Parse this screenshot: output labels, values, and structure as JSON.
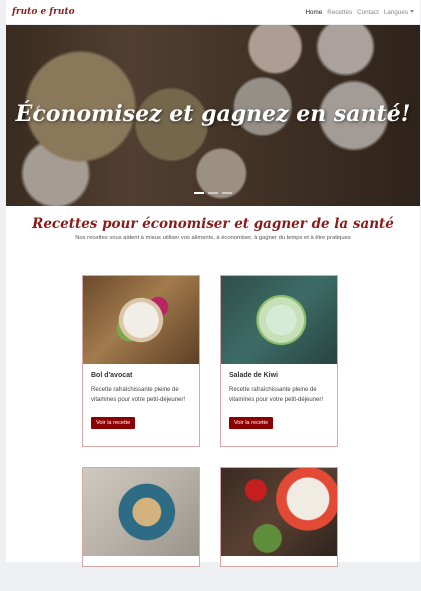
{
  "navbar": {
    "brand": "fruto e fruto",
    "links": [
      "Home",
      "Recettes",
      "Contact",
      "Langues"
    ]
  },
  "hero": {
    "title": "Économisez et gagnez en santé!"
  },
  "section": {
    "title": "Recettes pour économiser et gagner de la santé",
    "subtitle": "Nos recettes vous aident à mieux utiliser vos aliments, à économiser, à gagner du temps et à être pratiques"
  },
  "cards": [
    {
      "title": "Bol d'avocat",
      "text": "Recette rafraîchissante pleine de vitamines pour votre petit-déjeuner!",
      "button": "Voir la recette"
    },
    {
      "title": "Salade de Kiwi",
      "text": "Recette rafraîchissante pleine de vitamines pour votre petit-déjeuner!",
      "button": "Voir la recette"
    }
  ],
  "colors": {
    "accent": "#8b0000",
    "brand": "#8b1a1a"
  }
}
